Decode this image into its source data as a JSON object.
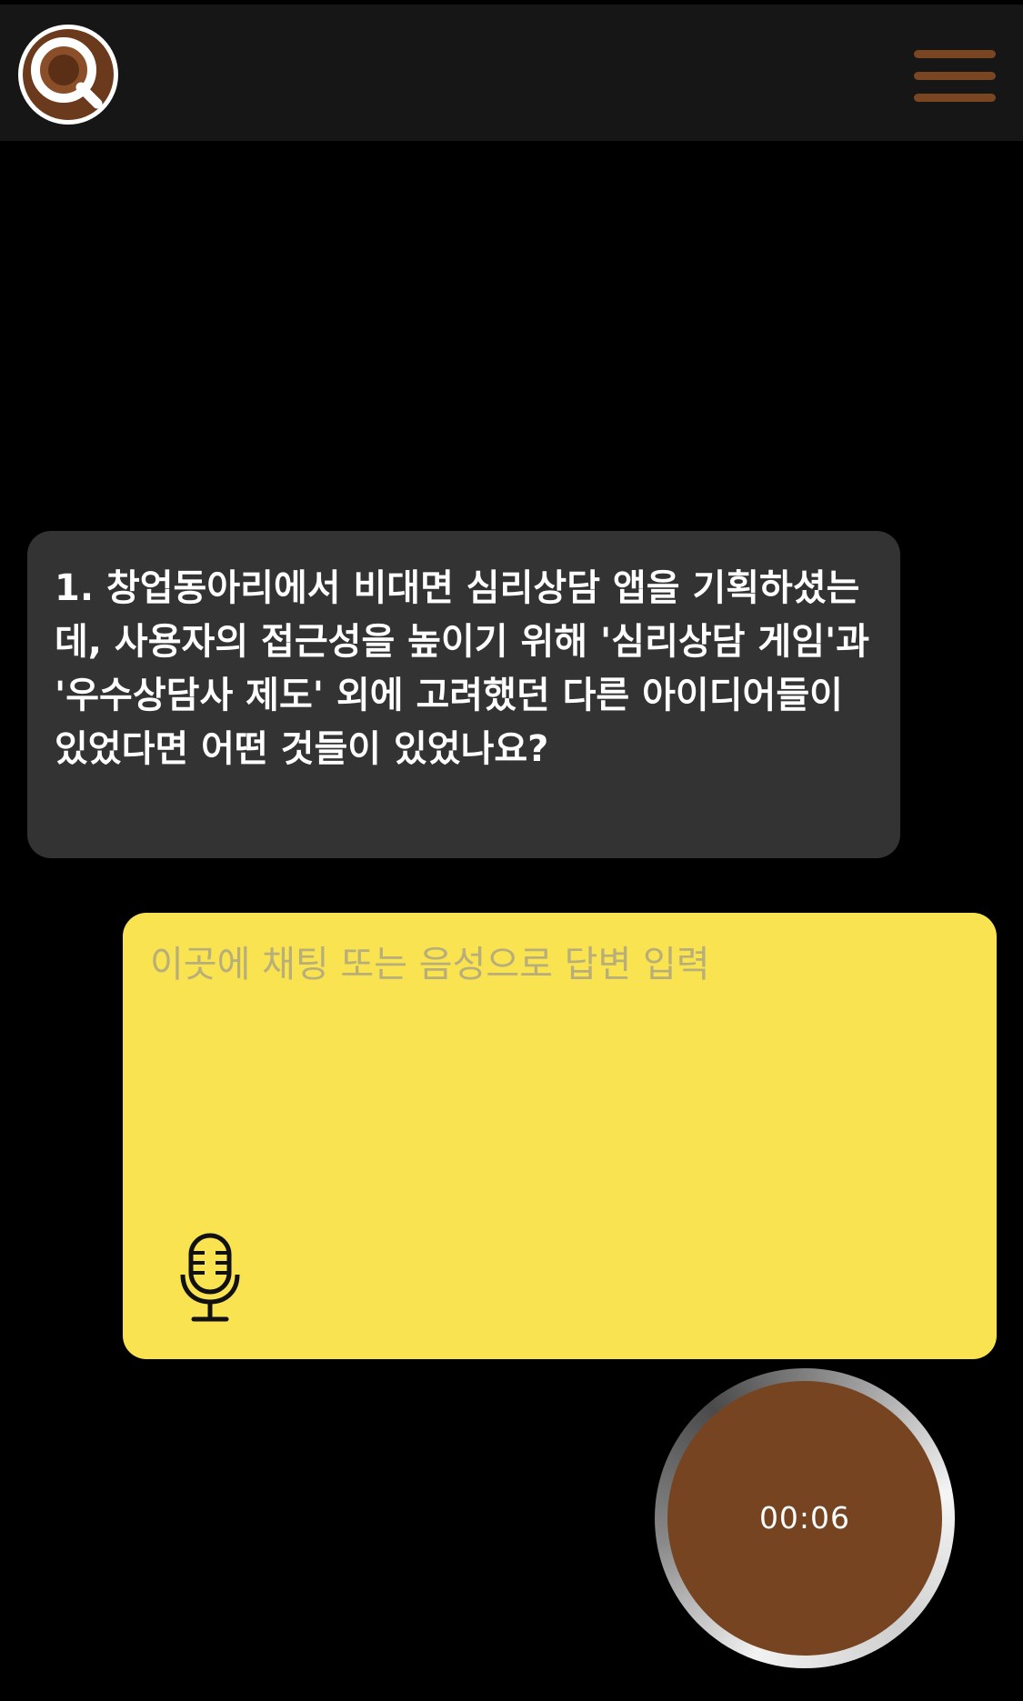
{
  "header": {
    "logo_icon": "magnifier-q-logo-icon",
    "menu_icon": "hamburger-menu-icon"
  },
  "question": {
    "text": "1. 창업동아리에서 비대면 심리상담 앱을 기획하셨는데, 사용자의 접근성을 높이기 위해 '심리상담 게임'과 '우수상담사 제도' 외에 고려했던 다른 아이디어들이 있었다면 어떤 것들이 있었나요?"
  },
  "answer": {
    "placeholder": "이곳에 채팅 또는 음성으로 답변 입력",
    "value": "",
    "mic_icon": "microphone-icon"
  },
  "recorder": {
    "timer": "00:06"
  },
  "colors": {
    "background": "#000000",
    "header": "#161616",
    "accent_brown": "#774422",
    "question_bubble": "#333333",
    "answer_yellow": "#f9e350",
    "placeholder": "#b8ae7a"
  }
}
